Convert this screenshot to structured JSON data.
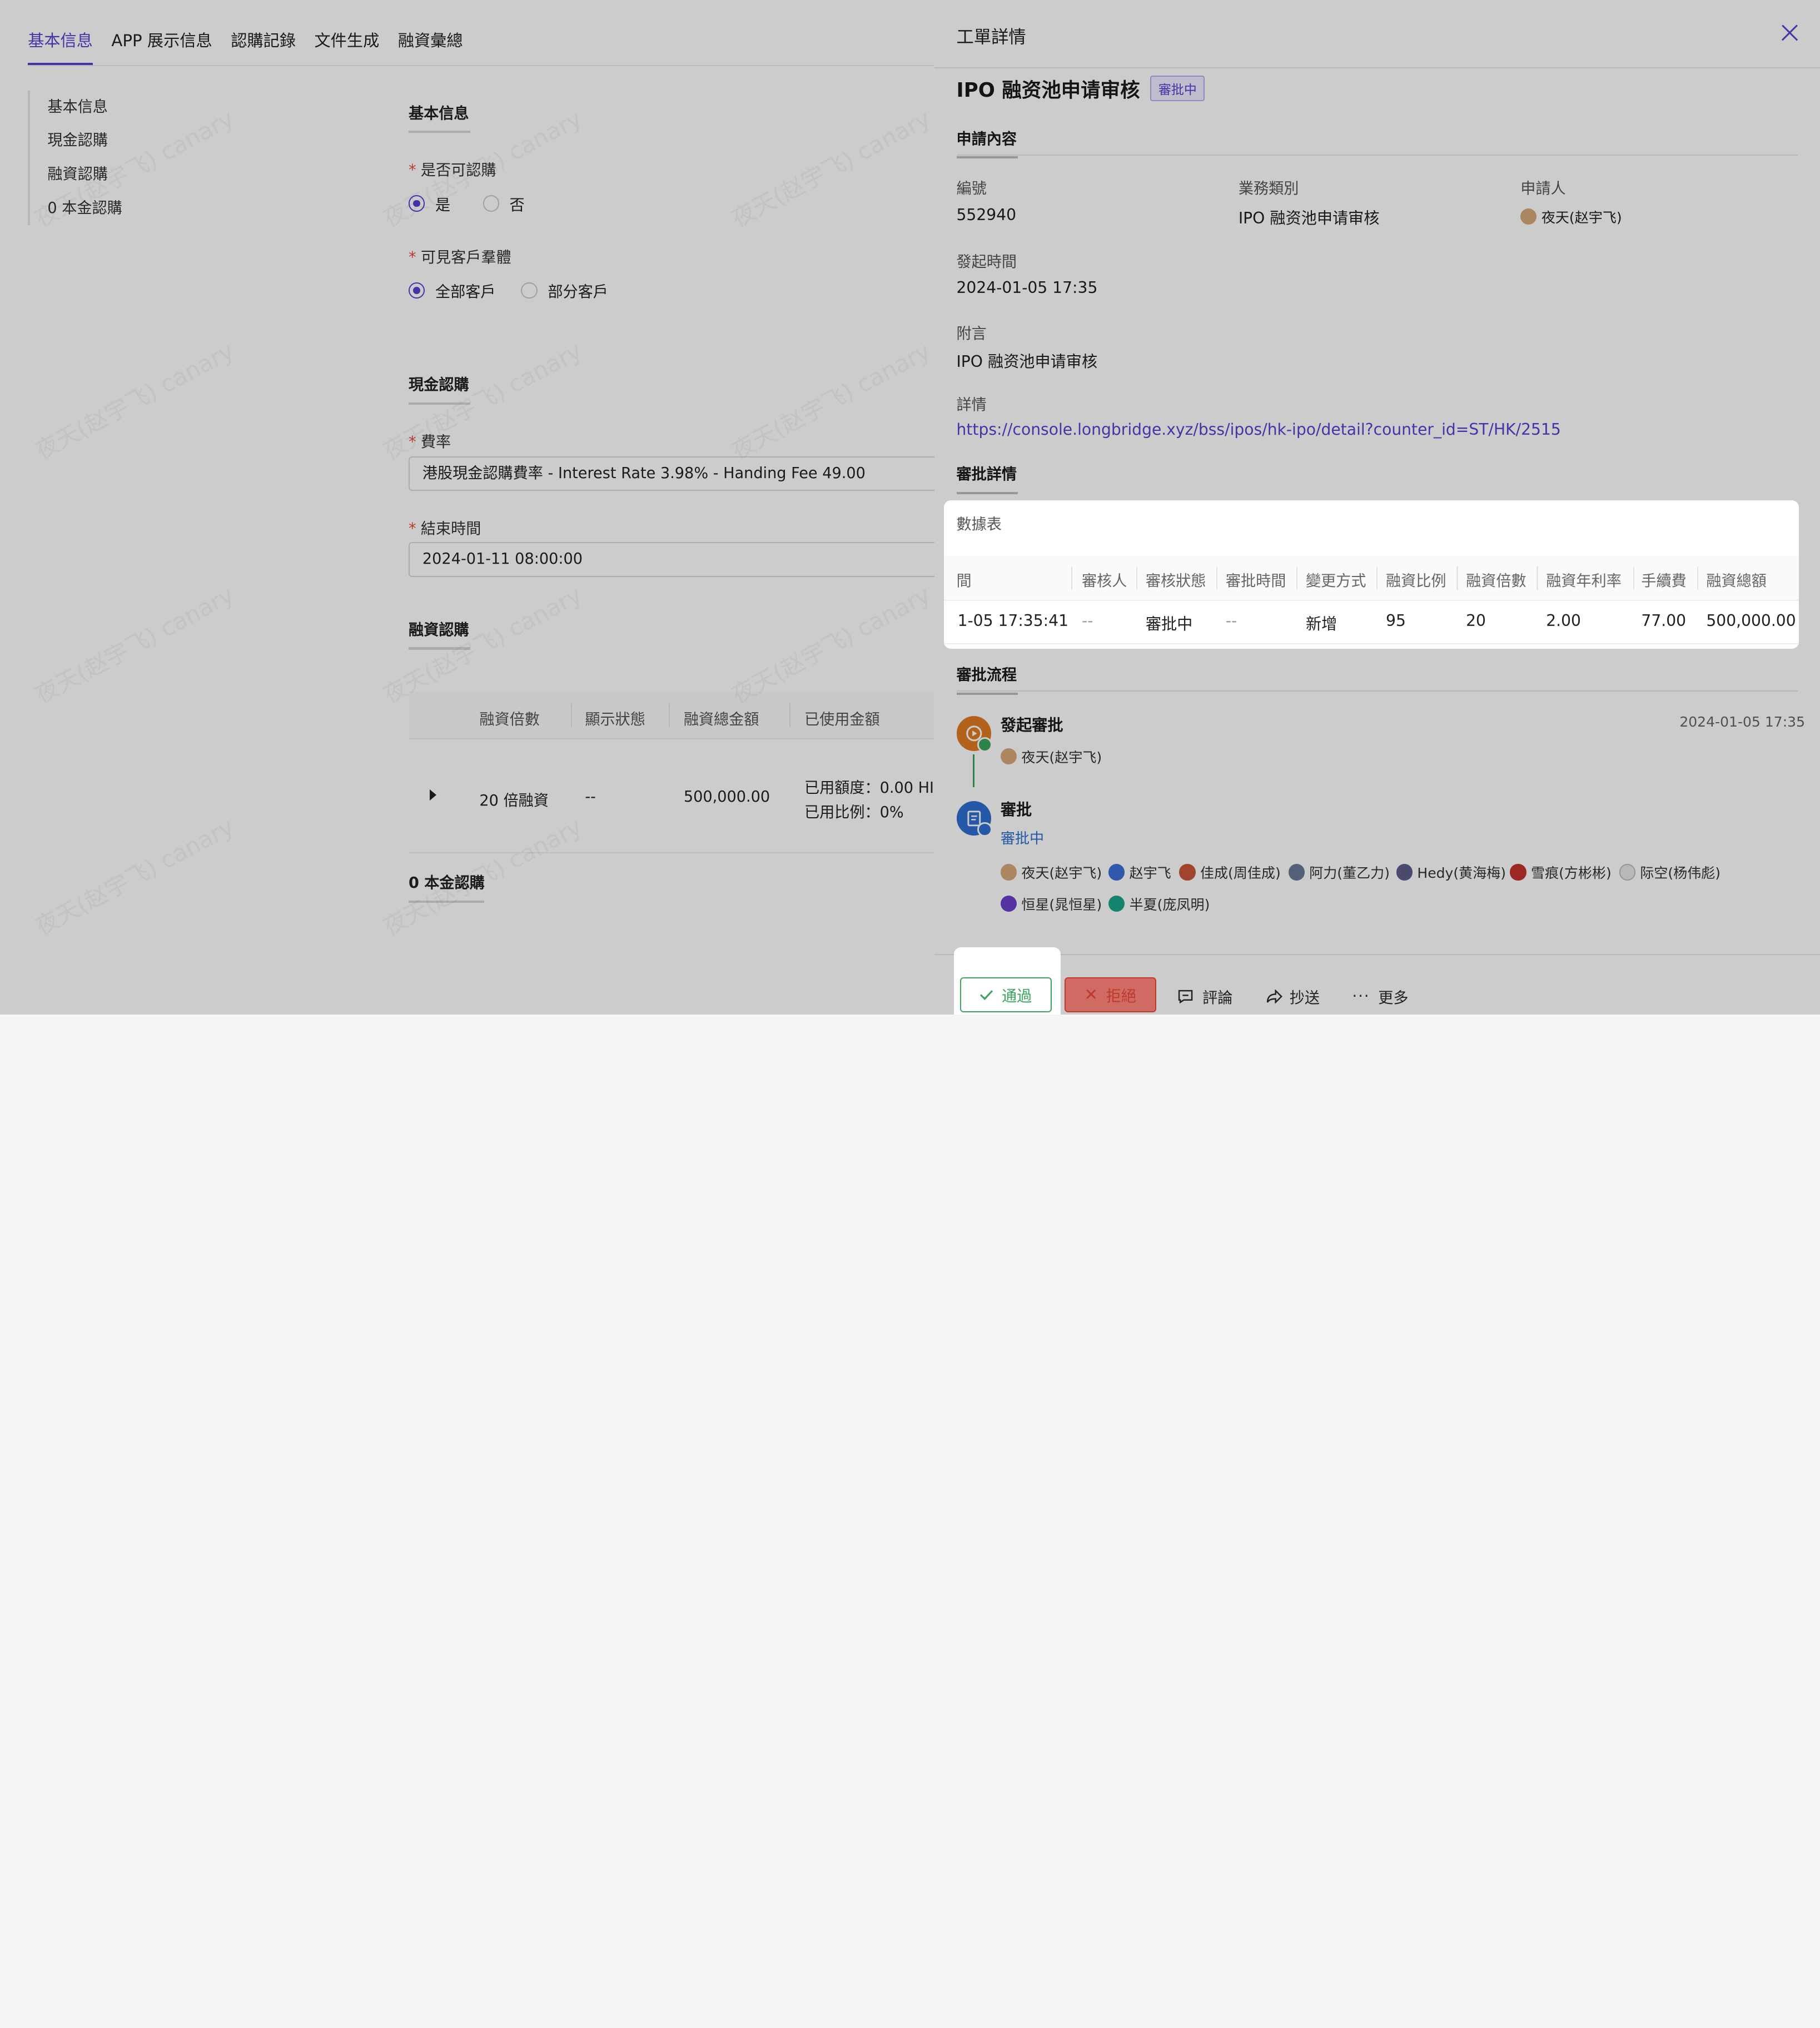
{
  "tabs": [
    "基本信息",
    "APP 展示信息",
    "認購記錄",
    "文件生成",
    "融資彙總"
  ],
  "anchor": [
    "基本信息",
    "現金認購",
    "融資認購",
    "0 本金認購"
  ],
  "basic": {
    "title": "基本信息",
    "subscribable_label": "是否可認購",
    "subscribable_yes": "是",
    "subscribable_no": "否",
    "visible_label": "可見客戶羣體",
    "visible_all": "全部客戶",
    "visible_part": "部分客戶"
  },
  "cash": {
    "title": "現金認購",
    "rate_label": "費率",
    "rate_value": "港股現金認購費率 - Interest Rate 3.98% - Handing Fee 49.00",
    "end_label": "結束時間",
    "end_value": "2024-01-11 08:00:00"
  },
  "finance": {
    "title": "融資認購",
    "headers": [
      "融資倍數",
      "顯示狀態",
      "融資總金額",
      "已使用金額"
    ],
    "row": {
      "multiple": "20 倍融資",
      "status": "--",
      "total": "500,000.00",
      "used_amount": "已用額度：0.00 HI",
      "used_ratio": "已用比例：0%"
    }
  },
  "zero": {
    "title": "0 本金認購"
  },
  "watermark": "夜天(赵宇飞) canary",
  "drawer": {
    "title": "工單詳情",
    "headline": "IPO 融资池申请审核",
    "badge": "審批中",
    "apply_section": "申請內容",
    "fields": {
      "no_label": "編號",
      "no": "552940",
      "biz_label": "業務類別",
      "biz": "IPO 融资池申请审核",
      "applicant_label": "申請人",
      "applicant": "夜天(赵宇飞)",
      "time_label": "發起時間",
      "time": "2024-01-05 17:35",
      "note_label": "附言",
      "note": "IPO 融资池申请审核",
      "detail_label": "詳情",
      "detail_link": "https://console.longbridge.xyz/bss/ipos/hk-ipo/detail?counter_id=ST/HK/2515"
    },
    "approval_section": "審批詳情",
    "table": {
      "caption": "數據表",
      "headers": [
        "間",
        "審核人",
        "審核狀態",
        "審批時間",
        "變更方式",
        "融資比例",
        "融資倍數",
        "融資年利率",
        "手續費",
        "融資總額"
      ],
      "row": [
        "1-05 17:35:41",
        "--",
        "審批中",
        "--",
        "新增",
        "95",
        "20",
        "2.00",
        "77.00",
        "500,000.00"
      ]
    },
    "flow_section": "審批流程",
    "flow": {
      "start_title": "發起審批",
      "start_time": "2024-01-05 17:35",
      "start_person": "夜天(赵宇飞)",
      "approve_title": "審批",
      "approve_status": "審批中",
      "approvers": [
        "夜天(赵宇飞)",
        "赵宇飞",
        "佳成(周佳成)",
        "阿力(董乙力)",
        "Hedy(黄海梅)",
        "雪痕(方彬彬)",
        "际空(杨伟彪)",
        "恒星(晁恒星)",
        "半夏(庞凤明)"
      ]
    },
    "actions": {
      "pass": "通過",
      "reject": "拒絕",
      "comment": "評論",
      "cc": "抄送",
      "more": "更多"
    }
  },
  "colors": {
    "accent": "#5b3fd1",
    "danger": "#e04b3b",
    "success": "#3aa55b",
    "link": "#5b3fd1"
  }
}
